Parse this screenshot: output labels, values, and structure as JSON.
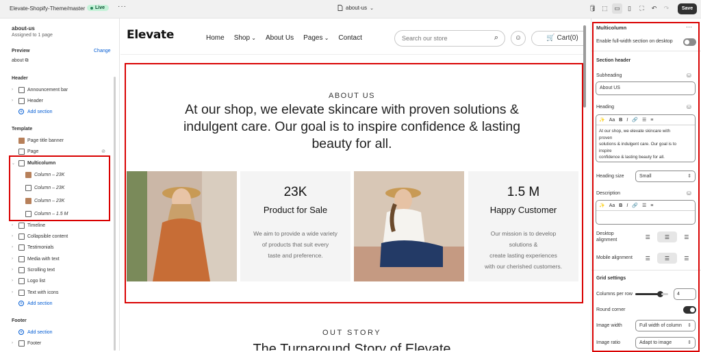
{
  "topbar": {
    "theme_name": "Elevate-Shopify-Theme/master",
    "status": "Live",
    "more": "···",
    "page": "about-us",
    "save": "Save"
  },
  "left": {
    "page_title": "about-us",
    "assigned": "Assigned to 1 page",
    "preview_label": "Preview",
    "change": "Change",
    "preview_value": "about",
    "header_group": "Header",
    "template_group": "Template",
    "footer_group": "Footer",
    "add_section": "Add section",
    "header_items": [
      "Announcement bar",
      "Header"
    ],
    "template_items": [
      "Page title banner",
      "Page",
      "Multicolumn"
    ],
    "columns": [
      "Column – 23K",
      "Column – 23K",
      "Column – 23K",
      "Column – 1.5 M"
    ],
    "more_items": [
      "Timeline",
      "Collapsible content",
      "Testimonials",
      "Media with text",
      "Scrolling text",
      "Logo list",
      "Text with icons"
    ],
    "footer_items": [
      "Footer"
    ]
  },
  "store": {
    "logo": "Elevate",
    "nav": [
      "Home",
      "Shop",
      "About Us",
      "Pages",
      "Contact"
    ],
    "search_placeholder": "Search our store",
    "cart": "Cart(0)",
    "about_label": "ABOUT US",
    "about_heading": "At our shop, we elevate skincare with proven solutions & indulgent care. Our goal is to inspire confidence & lasting beauty for all.",
    "cards": [
      {
        "num": "23K",
        "title": "Product for Sale",
        "desc": "We aim to provide a wide variety\nof products that suit every\ntaste and preference."
      },
      {
        "num": "1.5 M",
        "title": "Happy Customer",
        "desc": "Our mission is to develop\nsolutions &\ncreate lasting experiences\nwith our cherished customers."
      }
    ],
    "story_label": "OUT STORY",
    "story_heading": "The Turnaround Story of Elevate"
  },
  "panel": {
    "title": "Multicolumn",
    "more": "···",
    "full_width": "Enable full-width section on desktop",
    "section_header": "Section header",
    "subheading_label": "Subheading",
    "subheading_value": "About US",
    "heading_label": "Heading",
    "heading_value": "At our shop, we elevate skincare with\nproven\nsolutions & indulgent care. Our goal is to\ninspire\nconfidence & lasting beauty for all.",
    "heading_size_label": "Heading size",
    "heading_size_value": "Small",
    "description_label": "Description",
    "desktop_alignment": "Desktop alignment",
    "mobile_alignment": "Mobile alignment",
    "grid_settings": "Grid settings",
    "columns_label": "Columns per row",
    "columns_value": "4",
    "round_corner": "Round corner",
    "image_width_label": "Image width",
    "image_width_value": "Full width of column",
    "image_ratio_label": "Image ratio",
    "image_ratio_value": "Adapt to image",
    "rte_format": "Aa"
  },
  "colors": {
    "highlight": "#d90000",
    "link": "#005bd3",
    "live": "#c4f2d8"
  }
}
